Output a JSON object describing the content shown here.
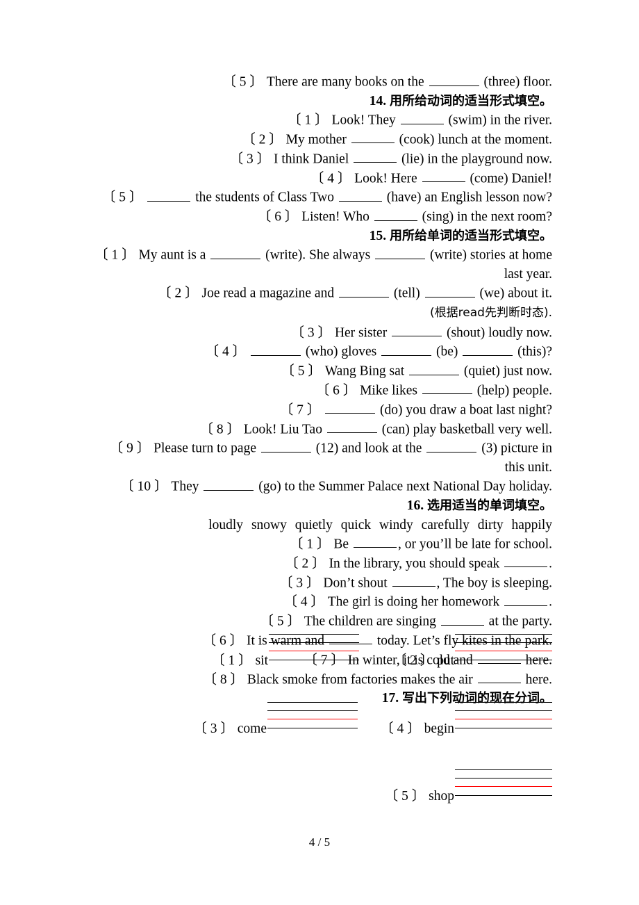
{
  "page": {
    "footer": "4 / 5",
    "accent_red": "#ff0000",
    "text_color": "#000000",
    "background": "#ffffff"
  },
  "carryover": {
    "item_label": "〔 5 〕",
    "text_before": "There are many books on the",
    "hint": "(three) floor."
  },
  "sections": [
    {
      "number": "14.",
      "title_cjk": "用所给动词的适当形式填空。",
      "items": [
        {
          "label": "〔 1 〕",
          "before": "Look! They",
          "after": "(swim) in the river."
        },
        {
          "label": "〔 2 〕",
          "before": "My mother",
          "after": "(cook) lunch at the moment."
        },
        {
          "label": "〔 3 〕",
          "before": "I think Daniel",
          "after": "(lie) in the playground now."
        },
        {
          "label": "〔 4 〕",
          "before": "Look! Here",
          "after": "(come) Daniel!"
        },
        {
          "label": "〔 5 〕",
          "before": "",
          "mid": "the students of Class Two",
          "after": "(have) an English lesson now?"
        },
        {
          "label": "〔 6 〕",
          "before": "Listen! Who",
          "after": "(sing) in the next room?"
        }
      ]
    },
    {
      "number": "15.",
      "title_cjk": "用所给单词的适当形式填空。",
      "items": [
        {
          "label": "〔 1 〕",
          "before": "My aunt is a",
          "mid": "(write). She always",
          "after": "(write) stories at home",
          "tail": "last year."
        },
        {
          "label": "〔 2 〕",
          "before": "Joe read a magazine and",
          "mid": "(tell)",
          "after": "(we) about it.",
          "note": "(根据read先判断时态)."
        },
        {
          "label": "〔 3 〕",
          "before": "Her sister",
          "after": "(shout) loudly now."
        },
        {
          "label": "〔 4 〕",
          "before": "",
          "mid": "(who) gloves",
          "mid2": "(be)",
          "after": "(this)?"
        },
        {
          "label": "〔 5 〕",
          "before": "Wang Bing sat",
          "after": "(quiet) just now."
        },
        {
          "label": "〔 6 〕",
          "before": "Mike likes",
          "after": "(help) people."
        },
        {
          "label": "〔 7 〕",
          "before": "",
          "after": "(do) you draw a boat last night?"
        },
        {
          "label": "〔 8 〕",
          "before": "Look! Liu Tao",
          "after": "(can) play basketball very well."
        },
        {
          "label": "〔 9 〕",
          "before": "Please turn to page",
          "mid": "(12) and look at the",
          "after": "(3) picture in",
          "tail": "this unit."
        },
        {
          "label": "〔 10 〕",
          "before": "They",
          "after": "(go) to the Summer Palace next National Day holiday."
        }
      ]
    },
    {
      "number": "16.",
      "title_cjk": "选用适当的单词填空。",
      "word_bank": [
        "loudly",
        "snowy",
        "quietly",
        "quick",
        "windy",
        "carefully",
        "dirty",
        "happily"
      ],
      "items": [
        {
          "label": "〔 1 〕",
          "before": "Be",
          "after": ", or you’ll be late for school."
        },
        {
          "label": "〔 2 〕",
          "before": "In the library, you should speak",
          "after": "."
        },
        {
          "label": "〔 3 〕",
          "before": "Don’t shout",
          "after": ", The boy is sleeping."
        },
        {
          "label": "〔 4 〕",
          "before": "The girl is doing her homework",
          "after": "."
        },
        {
          "label": "〔 5 〕",
          "before": "The children are singing",
          "after": "at the party."
        },
        {
          "label": "〔 6 〕",
          "before": "It is warm and",
          "after": "today. Let’s fly kites in the park."
        },
        {
          "label": "〔 7 〕",
          "before": "In winter, it is cold and",
          "after": "here."
        },
        {
          "label": "〔 8 〕",
          "before": "Black smoke from factories makes the air",
          "after": "here."
        }
      ]
    },
    {
      "number": "17.",
      "title_cjk": "写出下列动词的现在分词。",
      "verbs": [
        {
          "label": "〔 1 〕",
          "verb": "sit"
        },
        {
          "label": "〔 2 〕",
          "verb": "put"
        },
        {
          "label": "〔 3 〕",
          "verb": "come"
        },
        {
          "label": "〔 4 〕",
          "verb": "begin"
        },
        {
          "label": "〔 5 〕",
          "verb": "shop"
        }
      ]
    }
  ]
}
